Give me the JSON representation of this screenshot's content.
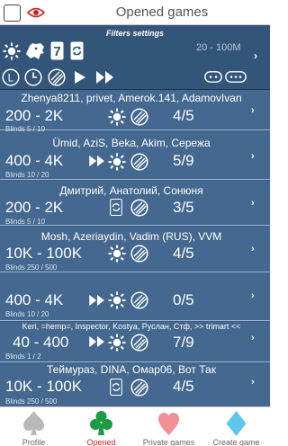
{
  "header": {
    "title": "Opened games"
  },
  "filters": {
    "label": "Filters settings",
    "range": "20 - 100M"
  },
  "games": [
    {
      "players": "Zhenya8211, privet, Amerok.141, AdamovIvan",
      "stakes": "200 - 2K",
      "blinds": "Blinds 5 / 10",
      "count": "4/5",
      "icons": [
        "sun-icon",
        "no-jokers-icon"
      ]
    },
    {
      "players": "Ümid, AziS, Beka, Akim, Сережа",
      "stakes": "400 - 4K",
      "blinds": "Blinds 10 / 20",
      "count": "5/9",
      "icons": [
        "double-play-icon",
        "sun-icon",
        "no-jokers-icon"
      ]
    },
    {
      "players": "Дмитрий, Анатолий, Сонюня",
      "stakes": "200 - 2K",
      "blinds": "Blinds 5 / 10",
      "count": "3/5",
      "icons": [
        "refresh-icon",
        "no-jokers-icon"
      ]
    },
    {
      "players": "Mosh, Azeriaydin, Vadim (RUS), VVM",
      "stakes": "10K - 100K",
      "blinds": "Blinds 250 / 500",
      "count": "4/5",
      "icons": [
        "sun-icon",
        "no-jokers-icon"
      ]
    },
    {
      "players": "",
      "stakes": "400 - 4K",
      "blinds": "Blinds 10 / 20",
      "count": "0/5",
      "icons": [
        "double-play-icon",
        "sun-icon",
        "no-jokers-icon"
      ]
    },
    {
      "players": "Keri, =hemp=, Inspector, Kostya, Руслан, Стф, >> trimart <<",
      "stakes": "40 - 400",
      "blinds": "Blinds 1 / 2",
      "count": "7/9",
      "icons": [
        "double-play-icon",
        "sun-icon",
        "no-jokers-icon"
      ]
    },
    {
      "players": "Теймураз, DINA, Омар06, Вот Так",
      "stakes": "10K - 100K",
      "blinds": "Blinds 250 / 500",
      "count": "4/5",
      "icons": [
        "refresh-icon",
        "no-jokers-icon"
      ]
    }
  ],
  "nav": [
    {
      "label": "Profile",
      "icon": "spade-icon",
      "active": false
    },
    {
      "label": "Opened",
      "icon": "club-icon",
      "active": true
    },
    {
      "label": "Private games",
      "icon": "heart-icon",
      "active": false
    },
    {
      "label": "Create game",
      "icon": "diamond-icon",
      "active": false
    }
  ]
}
